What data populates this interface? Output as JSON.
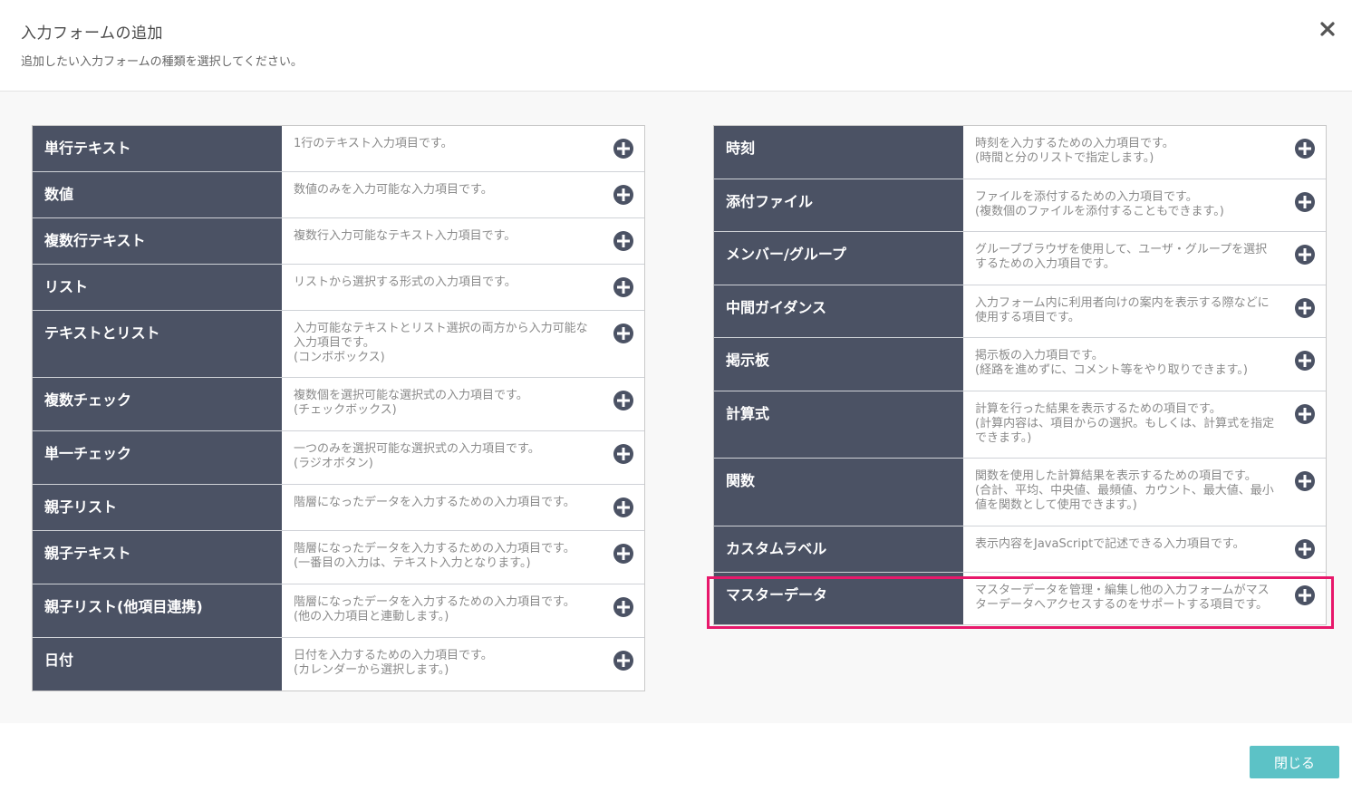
{
  "dialog": {
    "title": "入力フォームの追加",
    "subtitle": "追加したい入力フォームの種類を選択してください。"
  },
  "left_items": [
    {
      "name": "単行テキスト",
      "desc": "1行のテキスト入力項目です。"
    },
    {
      "name": "数値",
      "desc": "数値のみを入力可能な入力項目です。"
    },
    {
      "name": "複数行テキスト",
      "desc": "複数行入力可能なテキスト入力項目です。"
    },
    {
      "name": "リスト",
      "desc": "リストから選択する形式の入力項目です。"
    },
    {
      "name": "テキストとリスト",
      "desc": "入力可能なテキストとリスト選択の両方から入力可能な\n入力項目です。\n(コンボボックス)"
    },
    {
      "name": "複数チェック",
      "desc": "複数個を選択可能な選択式の入力項目です。\n(チェックボックス)"
    },
    {
      "name": "単一チェック",
      "desc": "一つのみを選択可能な選択式の入力項目です。\n(ラジオボタン)"
    },
    {
      "name": "親子リスト",
      "desc": "階層になったデータを入力するための入力項目です。"
    },
    {
      "name": "親子テキスト",
      "desc": "階層になったデータを入力するための入力項目です。\n(一番目の入力は、テキスト入力となります。)"
    },
    {
      "name": "親子リスト(他項目連携)",
      "desc": "階層になったデータを入力するための入力項目です。\n(他の入力項目と連動します。)"
    },
    {
      "name": "日付",
      "desc": "日付を入力するための入力項目です。\n(カレンダーから選択します。)"
    }
  ],
  "right_items": [
    {
      "name": "時刻",
      "desc": "時刻を入力するための入力項目です。\n(時間と分のリストで指定します。)"
    },
    {
      "name": "添付ファイル",
      "desc": "ファイルを添付するための入力項目です。\n(複数個のファイルを添付することもできます。)"
    },
    {
      "name": "メンバー/グループ",
      "desc": "グループブラウザを使用して、ユーザ・グループを選択\nするための入力項目です。"
    },
    {
      "name": "中間ガイダンス",
      "desc": "入力フォーム内に利用者向けの案内を表示する際などに\n使用する項目です。"
    },
    {
      "name": "掲示板",
      "desc": "掲示板の入力項目です。\n(経路を進めずに、コメント等をやり取りできます。)"
    },
    {
      "name": "計算式",
      "desc": "計算を行った結果を表示するための項目です。\n(計算内容は、項目からの選択。もしくは、計算式を指定\nできます。)"
    },
    {
      "name": "関数",
      "desc": "関数を使用した計算結果を表示するための項目です。\n(合計、平均、中央値、最頻値、カウント、最大値、最小\n値を関数として使用できます。)"
    },
    {
      "name": "カスタムラベル",
      "desc": "表示内容をJavaScriptで記述できる入力項目です。"
    },
    {
      "name": "マスターデータ",
      "desc": "マスターデータを管理・編集し他の入力フォームがマス\nターデータへアクセスするのをサポートする項目です。"
    }
  ],
  "footer": {
    "close_label": "閉じる"
  },
  "colors": {
    "accent": "#5cc2c6",
    "header_cell": "#4b5264",
    "highlight": "#e8186b"
  }
}
